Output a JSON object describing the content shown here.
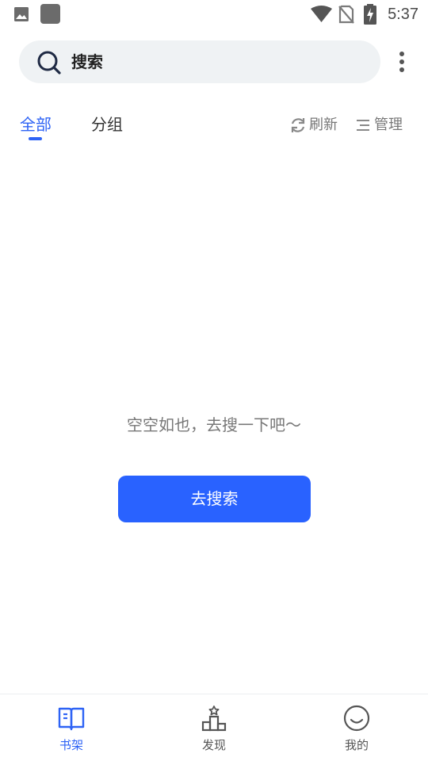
{
  "status_bar": {
    "time": "5:37",
    "icons": [
      "image-icon",
      "app-icon",
      "wifi-icon",
      "no-sim-icon",
      "battery-charging-icon"
    ]
  },
  "search": {
    "placeholder": "搜索",
    "icon": "search-icon"
  },
  "menu": {
    "icon": "more-vertical-icon"
  },
  "tabs": [
    {
      "label": "全部",
      "active": true
    },
    {
      "label": "分组",
      "active": false
    }
  ],
  "actions": {
    "refresh": {
      "label": "刷新",
      "icon": "refresh-icon"
    },
    "manage": {
      "label": "管理",
      "icon": "manage-lines-icon"
    }
  },
  "empty_state": {
    "message": "空空如也，去搜一下吧～",
    "button_label": "去搜索"
  },
  "bottom_nav": [
    {
      "label": "书架",
      "icon": "bookshelf-icon",
      "active": true
    },
    {
      "label": "发现",
      "icon": "discover-icon",
      "active": false
    },
    {
      "label": "我的",
      "icon": "profile-smile-icon",
      "active": false
    }
  ],
  "colors": {
    "accent": "#2e63f5",
    "button": "#2962ff",
    "search_bg": "#eff2f4",
    "inactive_text": "#555555"
  }
}
